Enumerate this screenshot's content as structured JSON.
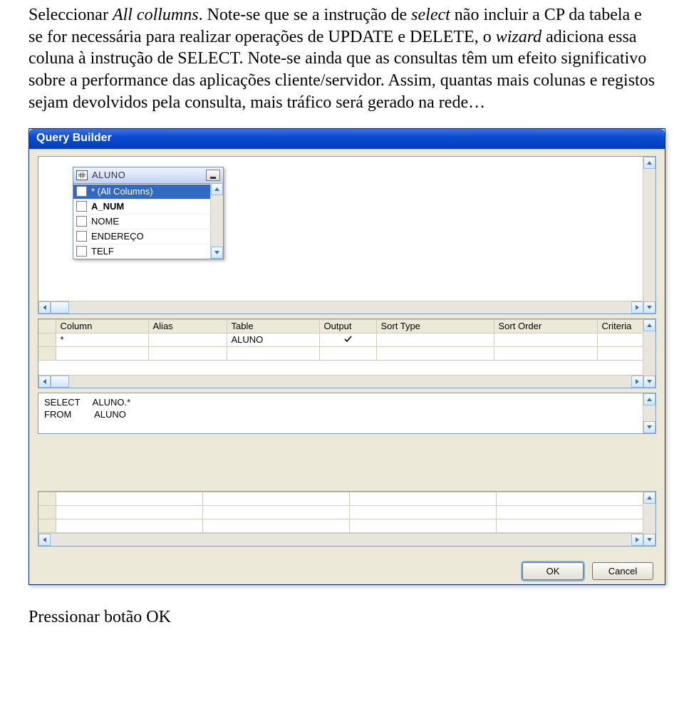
{
  "para1_parts": {
    "p0": "Seleccionar ",
    "p1": "All collumns",
    "p2": ". Note-se que se a instrução de ",
    "p3": "select",
    "p4": " não incluir a CP da tabela e se for necessária para realizar operações de UPDATE e DELETE, o ",
    "p5": "wizard",
    "p6": " adiciona essa coluna à instrução de SELECT. Note-se ainda que as consultas têm um efeito significativo sobre a performance das aplicações cliente/servidor. Assim, quantas mais colunas e registos sejam devolvidos pela consulta, mais tráfico será gerado na rede…"
  },
  "dialog": {
    "title": "Query Builder",
    "diagram": {
      "table_name": "ALUNO",
      "rows": [
        {
          "label": "* (All Columns)",
          "checked": true,
          "selected": true,
          "bold": false
        },
        {
          "label": "A_NUM",
          "checked": false,
          "selected": false,
          "bold": true
        },
        {
          "label": "NOME",
          "checked": false,
          "selected": false,
          "bold": false
        },
        {
          "label": "ENDEREÇO",
          "checked": false,
          "selected": false,
          "bold": false
        },
        {
          "label": "TELF",
          "checked": false,
          "selected": false,
          "bold": false
        }
      ]
    },
    "grid": {
      "headers": [
        "Column",
        "Alias",
        "Table",
        "Output",
        "Sort Type",
        "Sort Order",
        "Criteria"
      ],
      "rows": [
        {
          "Column": "*",
          "Alias": "",
          "Table": "ALUNO",
          "Output": true,
          "SortType": "",
          "SortOrder": "",
          "Criteria": ""
        }
      ]
    },
    "sql": {
      "line1_kw": "SELECT",
      "line1_rest": "     ALUNO.*",
      "line2_kw": "FROM",
      "line2_rest": "         ALUNO"
    },
    "buttons": {
      "ok": "OK",
      "cancel": "Cancel"
    }
  },
  "para2": "Pressionar botão OK"
}
